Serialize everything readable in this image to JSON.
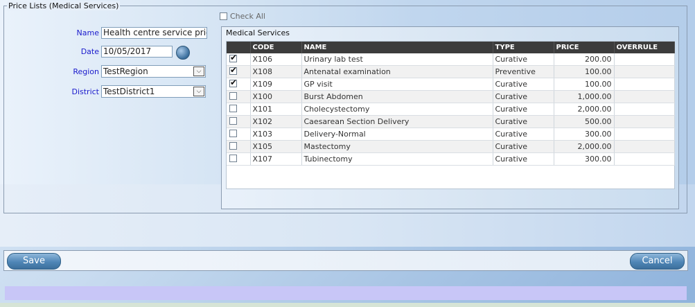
{
  "panel_title": "Price Lists (Medical Services)",
  "check_all_label": "Check All",
  "form": {
    "name_label": "Name",
    "name_value": "Health centre service pric",
    "date_label": "Date",
    "date_value": "10/05/2017",
    "region_label": "Region",
    "region_value": "TestRegion",
    "district_label": "District",
    "district_value": "TestDistrict1"
  },
  "medical_services": {
    "title": "Medical Services",
    "columns": [
      "",
      "CODE",
      "NAME",
      "TYPE",
      "PRICE",
      "OVERRULE"
    ],
    "rows": [
      {
        "checked": true,
        "code": "X106",
        "name": "Urinary lab test",
        "type": "Curative",
        "price": "200.00",
        "overrule": ""
      },
      {
        "checked": true,
        "code": "X108",
        "name": "Antenatal examination",
        "type": "Preventive",
        "price": "100.00",
        "overrule": ""
      },
      {
        "checked": true,
        "code": "X109",
        "name": "GP visit",
        "type": "Curative",
        "price": "100.00",
        "overrule": ""
      },
      {
        "checked": false,
        "code": "X100",
        "name": "Burst Abdomen",
        "type": "Curative",
        "price": "1,000.00",
        "overrule": ""
      },
      {
        "checked": false,
        "code": "X101",
        "name": "Cholecystectomy",
        "type": "Curative",
        "price": "2,000.00",
        "overrule": ""
      },
      {
        "checked": false,
        "code": "X102",
        "name": "Caesarean Section Delivery",
        "type": "Curative",
        "price": "500.00",
        "overrule": ""
      },
      {
        "checked": false,
        "code": "X103",
        "name": "Delivery-Normal",
        "type": "Curative",
        "price": "300.00",
        "overrule": ""
      },
      {
        "checked": false,
        "code": "X105",
        "name": "Mastectomy",
        "type": "Curative",
        "price": "2,000.00",
        "overrule": ""
      },
      {
        "checked": false,
        "code": "X107",
        "name": "Tubinectomy",
        "type": "Curative",
        "price": "300.00",
        "overrule": ""
      }
    ]
  },
  "buttons": {
    "save_label": "Save",
    "cancel_label": "Cancel"
  }
}
